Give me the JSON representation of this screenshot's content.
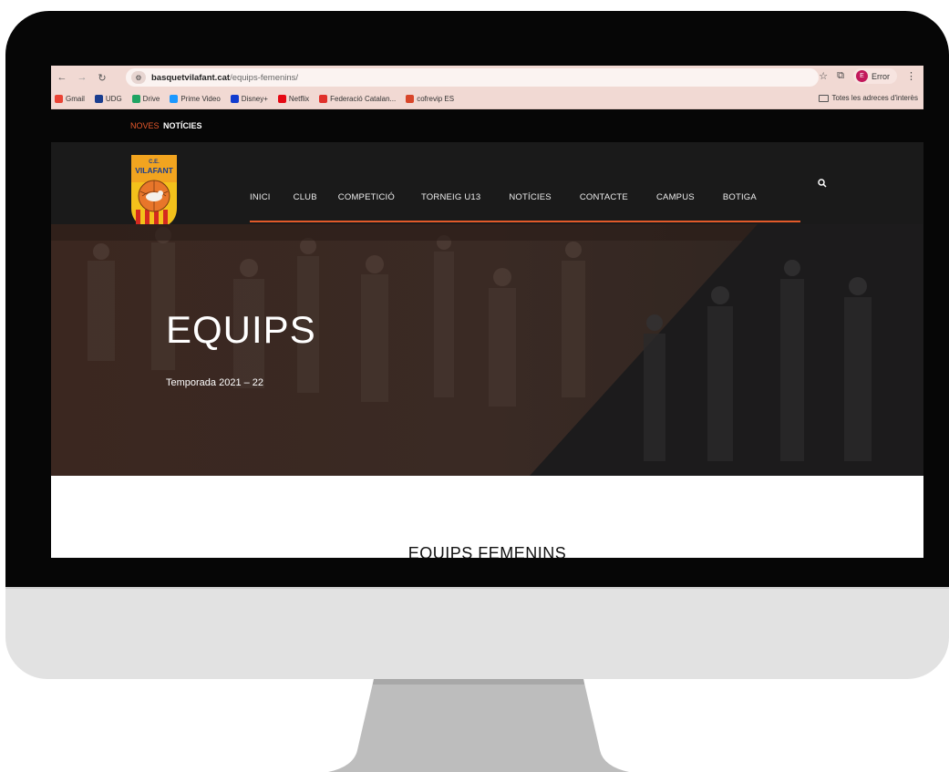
{
  "browser": {
    "url_host": "basquetvilafant.cat",
    "url_path": "/equips-femenins/",
    "profile_label": "Error",
    "profile_initial": "E",
    "bookmarks": [
      {
        "label": "Gmail",
        "icon": "gmail-icon",
        "color": "#ea4335"
      },
      {
        "label": "UDG",
        "icon": "udg-icon",
        "color": "#1a3d8f"
      },
      {
        "label": "Drive",
        "icon": "drive-icon",
        "color": "#1fa463"
      },
      {
        "label": "Prime Video",
        "icon": "prime-video-icon",
        "color": "#1a98ff"
      },
      {
        "label": "Disney+",
        "icon": "disney-icon",
        "color": "#113ccf"
      },
      {
        "label": "Netflix",
        "icon": "netflix-icon",
        "color": "#e50914"
      },
      {
        "label": "Federació Catalan...",
        "icon": "federacio-icon",
        "color": "#e0312b"
      },
      {
        "label": "cofrevip ES",
        "icon": "cofrevip-icon",
        "color": "#d8462a"
      }
    ],
    "all_bookmarks_label": "Totes les adreces d'interès"
  },
  "ticker": {
    "prefix": "NOVES",
    "label": "NOTÍCIES"
  },
  "site": {
    "logo_text_top": "C.E.",
    "logo_text": "VILAFANT",
    "menu": [
      "INICI",
      "CLUB",
      "COMPETICIÓ",
      "TORNEIG U13",
      "NOTÍCIES",
      "CONTACTE",
      "CAMPUS",
      "BOTIGA"
    ]
  },
  "hero": {
    "title": "EQUIPS",
    "subtitle": "Temporada 2021 – 22"
  },
  "content": {
    "section_title": "EQUIPS FEMENINS"
  },
  "colors": {
    "accent": "#e25a2a",
    "header_bg": "#1a1a1a",
    "browser_chrome": "#f1d9d3"
  }
}
